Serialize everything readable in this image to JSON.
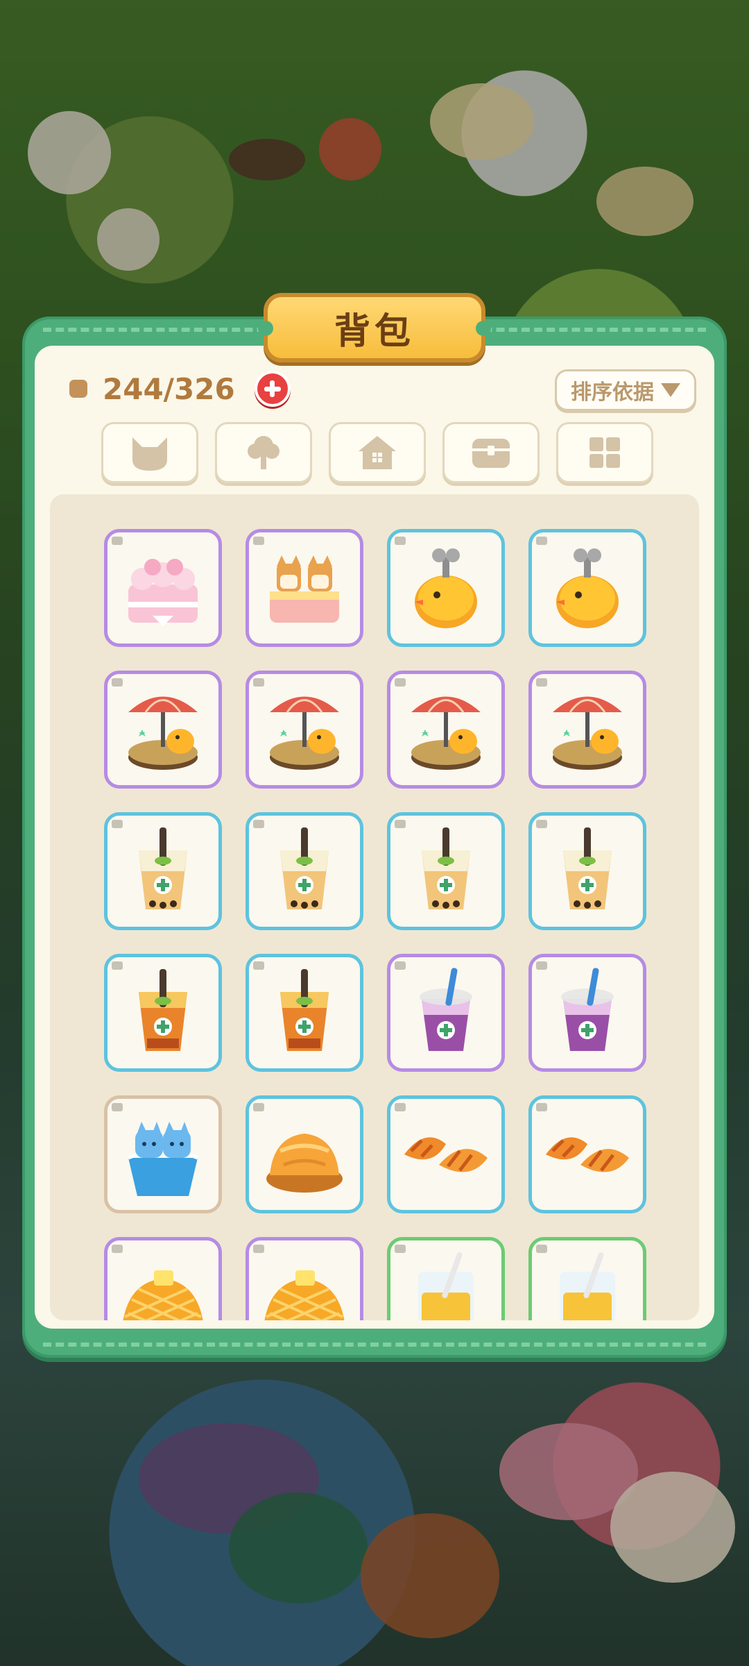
{
  "panel": {
    "title": "背包",
    "capacity_text": "244/326",
    "sort_label": "排序依据"
  },
  "tabs": [
    {
      "icon": "cat-head-icon"
    },
    {
      "icon": "tree-icon"
    },
    {
      "icon": "house-icon"
    },
    {
      "icon": "chest-icon"
    },
    {
      "icon": "grid-icon"
    }
  ],
  "items": [
    {
      "icon": "pink-cake-icon",
      "rarity": "purple"
    },
    {
      "icon": "cat-cake-icon",
      "rarity": "purple"
    },
    {
      "icon": "windup-chick-icon",
      "rarity": "blue"
    },
    {
      "icon": "windup-chick-icon",
      "rarity": "blue"
    },
    {
      "icon": "chick-umbrella-table-icon",
      "rarity": "purple"
    },
    {
      "icon": "chick-umbrella-table-icon",
      "rarity": "purple"
    },
    {
      "icon": "chick-umbrella-table-icon",
      "rarity": "purple"
    },
    {
      "icon": "chick-umbrella-table-icon",
      "rarity": "purple"
    },
    {
      "icon": "milk-tea-icon",
      "rarity": "blue"
    },
    {
      "icon": "milk-tea-icon",
      "rarity": "blue"
    },
    {
      "icon": "milk-tea-icon",
      "rarity": "blue"
    },
    {
      "icon": "milk-tea-icon",
      "rarity": "blue"
    },
    {
      "icon": "orange-tea-icon",
      "rarity": "blue"
    },
    {
      "icon": "orange-tea-icon",
      "rarity": "blue"
    },
    {
      "icon": "grape-tea-icon",
      "rarity": "purple"
    },
    {
      "icon": "grape-tea-icon",
      "rarity": "purple"
    },
    {
      "icon": "cat-basket-icon",
      "rarity": "brown"
    },
    {
      "icon": "bread-bun-icon",
      "rarity": "blue"
    },
    {
      "icon": "croissant-icon",
      "rarity": "blue"
    },
    {
      "icon": "croissant-icon",
      "rarity": "blue"
    },
    {
      "icon": "pineapple-bun-icon",
      "rarity": "purple"
    },
    {
      "icon": "pineapple-bun-icon",
      "rarity": "purple"
    },
    {
      "icon": "juice-glass-icon",
      "rarity": "green"
    },
    {
      "icon": "juice-glass-icon",
      "rarity": "green"
    }
  ],
  "colors": {
    "panel_green": "#4eae7b",
    "rarity_blue": "#5ec3de",
    "rarity_purple": "#b68be4",
    "rarity_green": "#6ccb73",
    "title_gold": "#f7bd3c"
  }
}
